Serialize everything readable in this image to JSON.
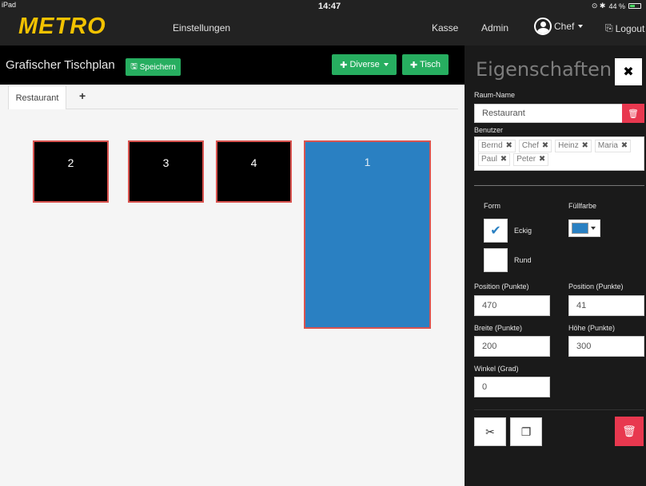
{
  "status": {
    "device": "iPad",
    "time": "14:47",
    "battery": "44 %",
    "indicators": "⊙ ✱"
  },
  "header": {
    "logo": "METRO",
    "nav_settings": "Einstellungen",
    "nav_kasse": "Kasse",
    "nav_admin": "Admin",
    "user_menu": "Chef",
    "logout": "Logout"
  },
  "toolbar": {
    "title": "Grafischer Tischplan",
    "save_label": "Speichern",
    "diverse_label": "Diverse",
    "tisch_label": "Tisch"
  },
  "tabs": {
    "active": "Restaurant",
    "add": "+"
  },
  "tables": [
    {
      "label": "2"
    },
    {
      "label": "3"
    },
    {
      "label": "4"
    },
    {
      "label": "1"
    }
  ],
  "panel": {
    "title": "Eigenschaften",
    "close": "✖",
    "room_name_label": "Raum-Name",
    "room_name_value": "Restaurant",
    "users_label": "Benutzer",
    "users": [
      "Bernd",
      "Chef",
      "Heinz",
      "Maria",
      "Paul",
      "Peter"
    ],
    "form_label": "Form",
    "fill_label": "Füllfarbe",
    "fill_color": "#2a80c2",
    "shape_options": [
      "Eckig",
      "Rund"
    ],
    "shape_selected": "Eckig",
    "pos_x_label": "Position (Punkte)",
    "pos_x_value": "470",
    "pos_y_label": "Position (Punkte)",
    "pos_y_value": "41",
    "width_label": "Breite (Punkte)",
    "width_value": "200",
    "height_label": "Höhe (Punkte)",
    "height_value": "300",
    "angle_label": "Winkel (Grad)",
    "angle_value": "0"
  },
  "colors": {
    "header_bg": "#222222",
    "logo": "#f2c200",
    "green": "#27ae60",
    "selected_table": "#2a80c2",
    "table_border": "#d9534f",
    "danger": "#e8384f"
  }
}
